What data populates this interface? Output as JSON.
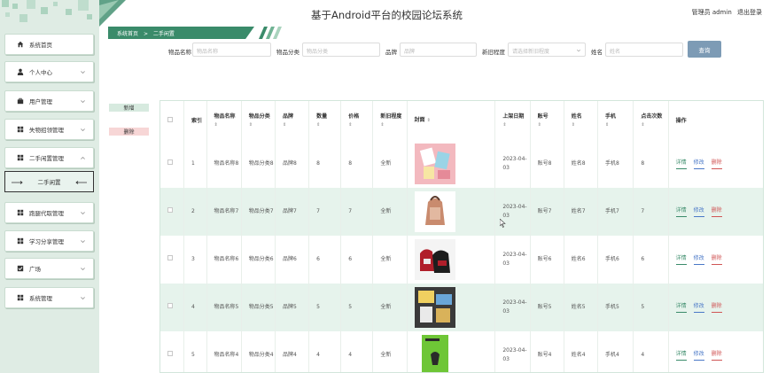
{
  "header": {
    "title": "基于Android平台的校园论坛系统",
    "user_label": "管理员 admin",
    "logout_label": "退出登录"
  },
  "breadcrumb": {
    "home": "系统首页",
    "sep": ">",
    "current": "二手闲置"
  },
  "sidebar": {
    "items": [
      {
        "label": "系统首页",
        "icon": "home-icon"
      },
      {
        "label": "个人中心",
        "icon": "user-icon"
      },
      {
        "label": "用户管理",
        "icon": "briefcase-icon"
      },
      {
        "label": "失物招领管理",
        "icon": "grid-icon"
      },
      {
        "label": "二手闲置管理",
        "icon": "grid-icon"
      },
      {
        "label": "跑腿代取管理",
        "icon": "grid-icon"
      },
      {
        "label": "学习分享管理",
        "icon": "grid-icon"
      },
      {
        "label": "广场",
        "icon": "check-icon"
      },
      {
        "label": "系统管理",
        "icon": "grid-icon"
      }
    ],
    "submenu": {
      "label": "二手闲置"
    }
  },
  "search": {
    "name_label": "物品名称",
    "name_placeholder": "物品名称",
    "category_label": "物品分类",
    "category_placeholder": "物品分类",
    "brand_label": "品牌",
    "brand_placeholder": "品牌",
    "condition_label": "新旧程度",
    "condition_placeholder": "请选择新旧程度",
    "person_label": "姓名",
    "person_placeholder": "姓名",
    "button": "查询"
  },
  "actions": {
    "add": "新增",
    "delete": "删除"
  },
  "table": {
    "headers": {
      "index": "索引",
      "name": "物品名称",
      "category": "物品分类",
      "brand": "品牌",
      "qty": "数量",
      "price": "价格",
      "condition": "新旧程度",
      "cover": "封面",
      "date": "上架日期",
      "account": "账号",
      "person": "姓名",
      "phone": "手机",
      "clicks": "点击次数",
      "ops": "操作"
    },
    "sort_glyph": "⇕",
    "rows": [
      {
        "index": "1",
        "name": "物品名称8",
        "category": "物品分类8",
        "brand": "品牌8",
        "qty": "8",
        "price": "8",
        "condition": "全新",
        "date": "2023-04-03",
        "account": "账号8",
        "person": "姓名8",
        "phone": "手机8",
        "clicks": "8"
      },
      {
        "index": "2",
        "name": "物品名称7",
        "category": "物品分类7",
        "brand": "品牌7",
        "qty": "7",
        "price": "7",
        "condition": "全新",
        "date": "2023-04-03",
        "account": "账号7",
        "person": "姓名7",
        "phone": "手机7",
        "clicks": "7"
      },
      {
        "index": "3",
        "name": "物品名称6",
        "category": "物品分类6",
        "brand": "品牌6",
        "qty": "6",
        "price": "6",
        "condition": "全新",
        "date": "2023-04-03",
        "account": "账号6",
        "person": "姓名6",
        "phone": "手机6",
        "clicks": "6"
      },
      {
        "index": "4",
        "name": "物品名称5",
        "category": "物品分类5",
        "brand": "品牌5",
        "qty": "5",
        "price": "5",
        "condition": "全新",
        "date": "2023-04-03",
        "account": "账号5",
        "person": "姓名5",
        "phone": "手机5",
        "clicks": "5"
      },
      {
        "index": "5",
        "name": "物品名称4",
        "category": "物品分类4",
        "brand": "品牌4",
        "qty": "4",
        "price": "4",
        "condition": "全新",
        "date": "2023-04-03",
        "account": "账号4",
        "person": "姓名4",
        "phone": "手机4",
        "clicks": "4"
      }
    ],
    "ops": {
      "detail": "详情",
      "edit": "修改",
      "delete": "删除"
    }
  },
  "colors": {
    "accent": "#3a8b6a",
    "row_alt": "#e6f3ec",
    "sidebar_bg": "#dfece4",
    "query_btn": "#7d9bb5"
  }
}
